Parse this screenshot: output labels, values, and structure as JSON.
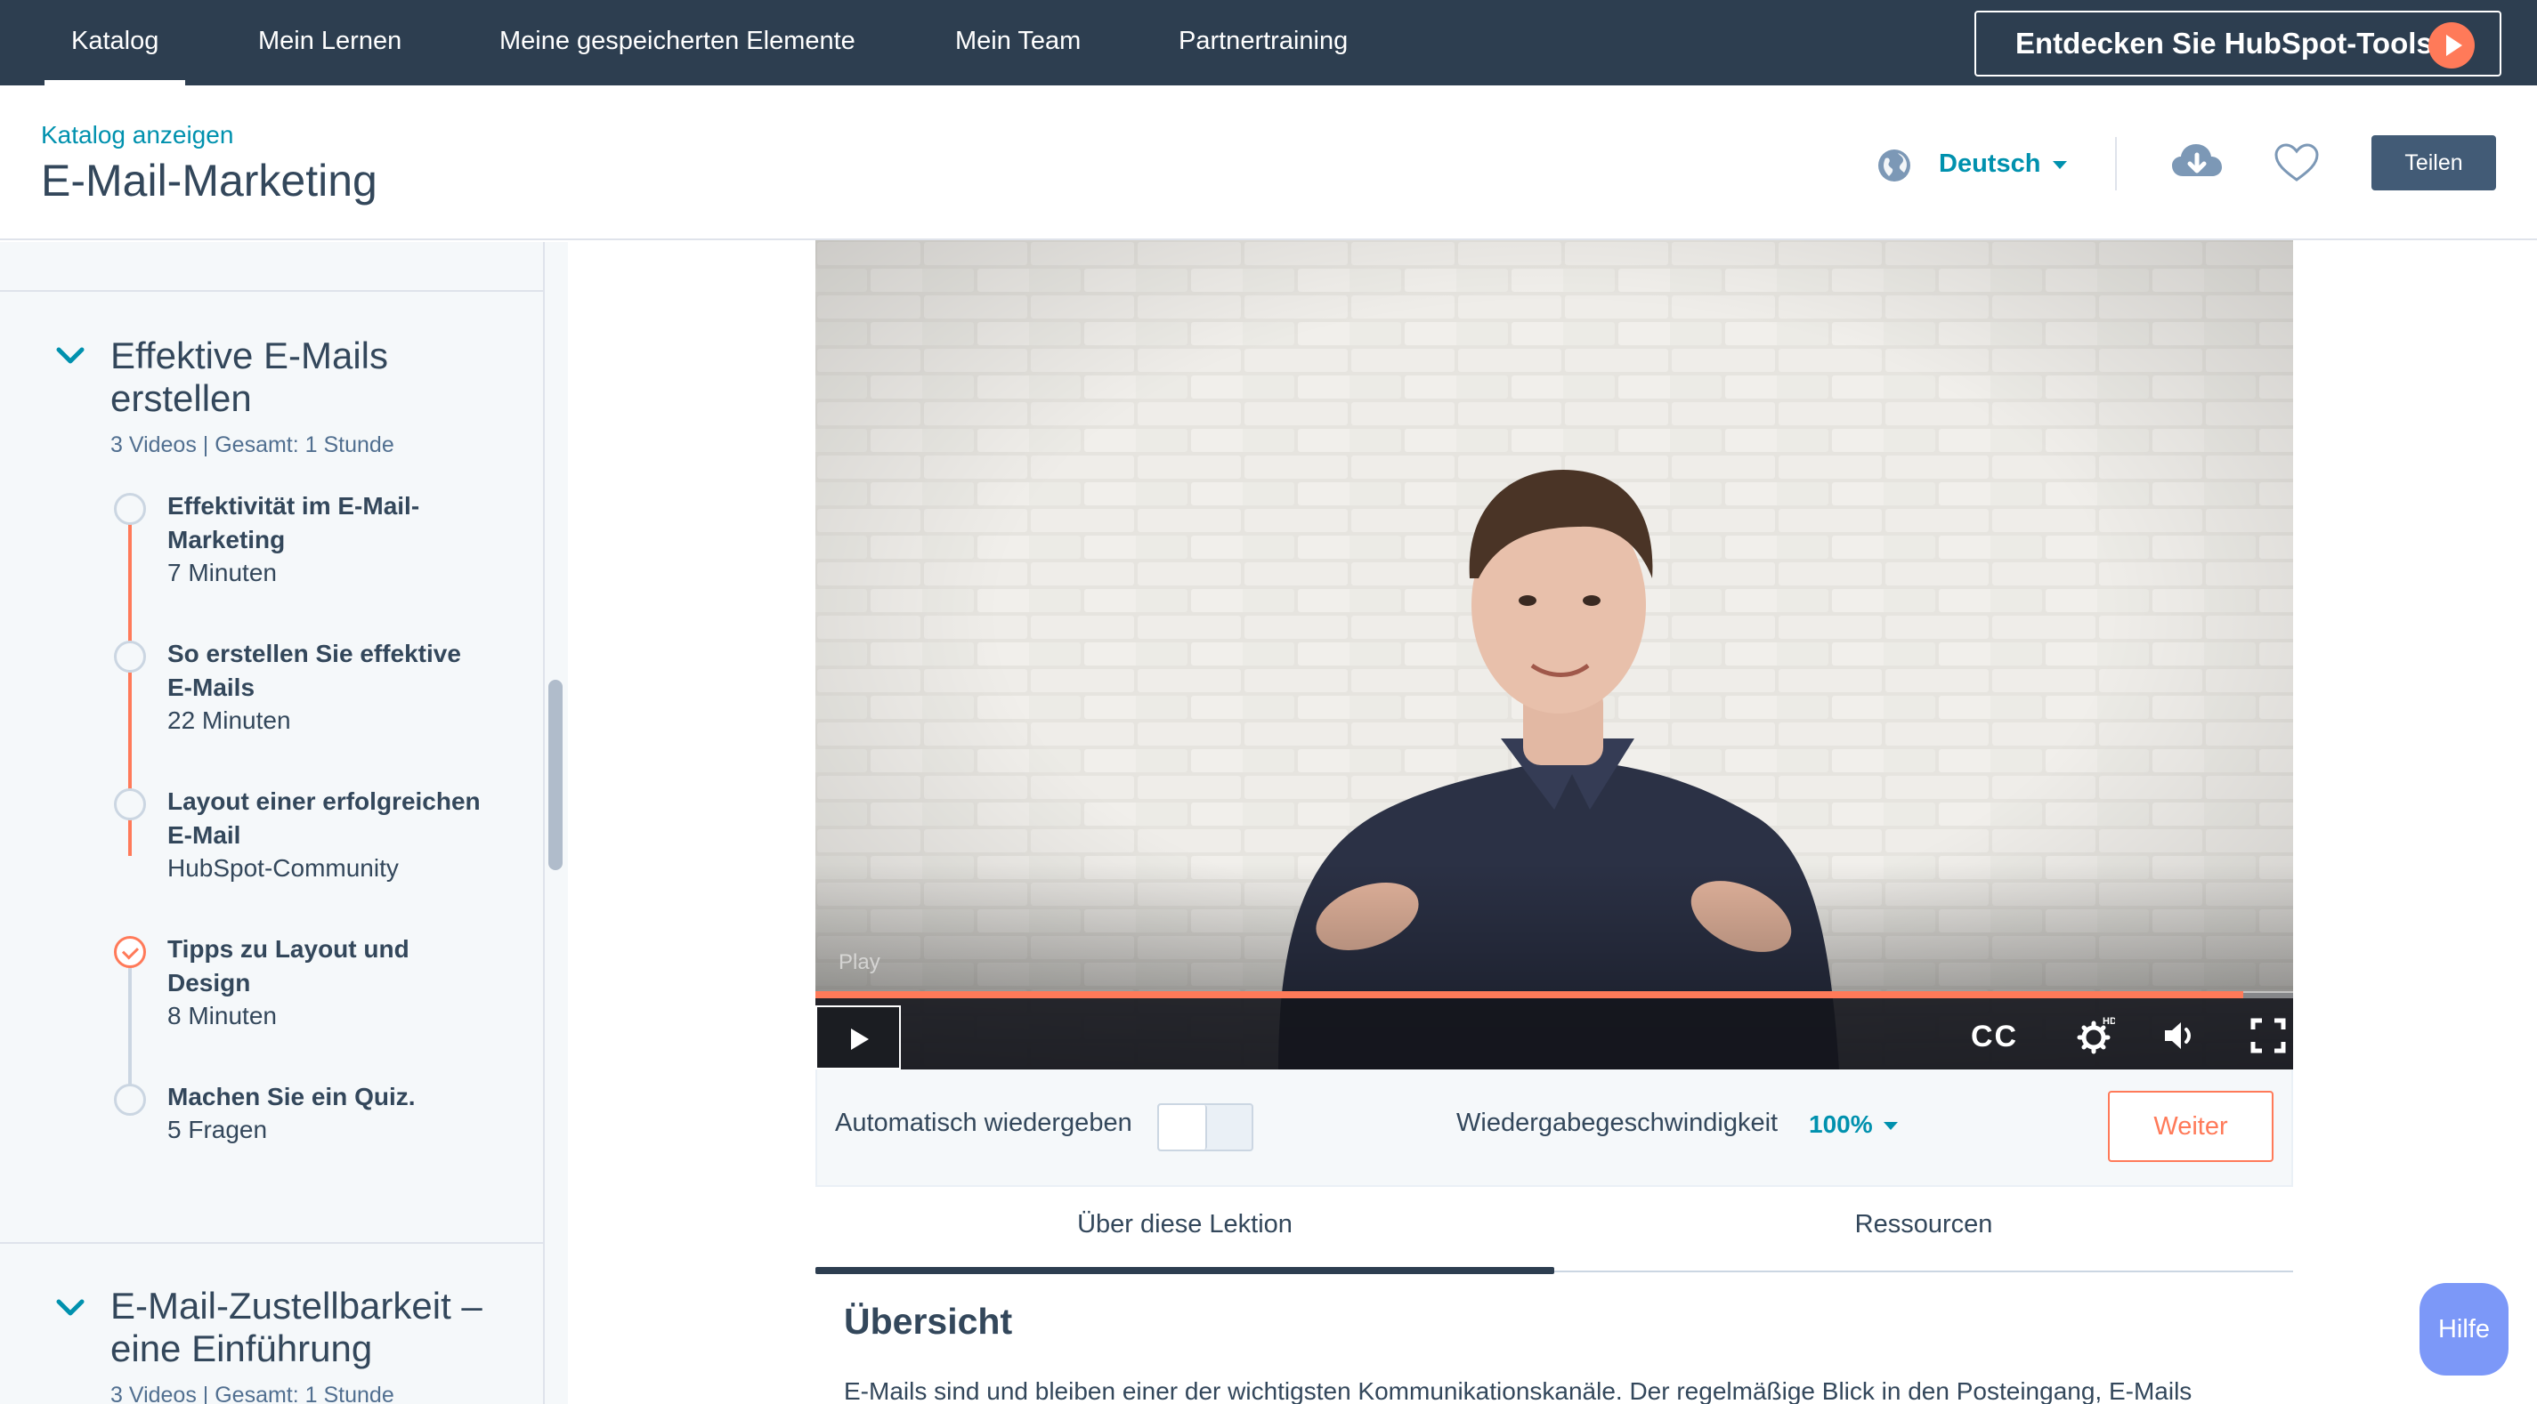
{
  "nav": {
    "items": [
      {
        "label": "Katalog",
        "active": true
      },
      {
        "label": "Mein Lernen",
        "active": false
      },
      {
        "label": "Meine gespeicherten Elemente",
        "active": false
      },
      {
        "label": "Mein Team",
        "active": false
      },
      {
        "label": "Partnertraining",
        "active": false
      }
    ],
    "explore_button": "Entdecken Sie HubSpot-Tools",
    "explore_icon": "play-icon",
    "bg_color": "#2d3e50"
  },
  "header": {
    "catalog_link": "Katalog anzeigen",
    "title": "E-Mail-Marketing",
    "language": "Deutsch",
    "language_icon": "globe-icon",
    "download_icon": "cloud-download-icon",
    "favorite_icon": "heart-icon",
    "share_button": "Teilen"
  },
  "sidebar": {
    "sections": [
      {
        "title": "Effektive E-Mails erstellen",
        "meta": "3 Videos | Gesamt: 1 Stunde",
        "expanded": true,
        "lessons": [
          {
            "title": "Effektivität im E-Mail-Marketing",
            "sub": "7 Minuten",
            "state": "not-started"
          },
          {
            "title": "So erstellen Sie effektive E-Mails",
            "sub": "22 Minuten",
            "state": "not-started"
          },
          {
            "title": "Layout einer erfolgreichen E-Mail",
            "sub": "HubSpot-Community",
            "state": "not-started"
          },
          {
            "title": "Tipps zu Layout und Design",
            "sub": "8 Minuten",
            "state": "current"
          },
          {
            "title": "Machen Sie ein Quiz.",
            "sub": "5 Fragen",
            "state": "not-started"
          }
        ]
      },
      {
        "title": "E-Mail-Zustellbarkeit – eine Einführung",
        "meta": "3 Videos | Gesamt: 1 Stunde",
        "expanded": true
      }
    ]
  },
  "video": {
    "play_tooltip": "Play",
    "progress": 0.966,
    "cc_label": "CC",
    "settings_badge": "HD",
    "accent_color": "#ff7a59"
  },
  "player_bar": {
    "autoplay_label": "Automatisch wiedergeben",
    "autoplay_on": false,
    "speed_label": "Wiedergabegeschwindigkeit",
    "speed_value": "100%",
    "next_button": "Weiter"
  },
  "tabs": [
    {
      "label": "Über diese Lektion",
      "active": true
    },
    {
      "label": "Ressourcen",
      "active": false
    }
  ],
  "overview": {
    "title": "Übersicht",
    "text": "E-Mails sind und bleiben einer der wichtigsten Kommunikationskanäle. Der regelmäßige Blick in den Posteingang, E-Mails"
  },
  "help_button": "Hilfe"
}
